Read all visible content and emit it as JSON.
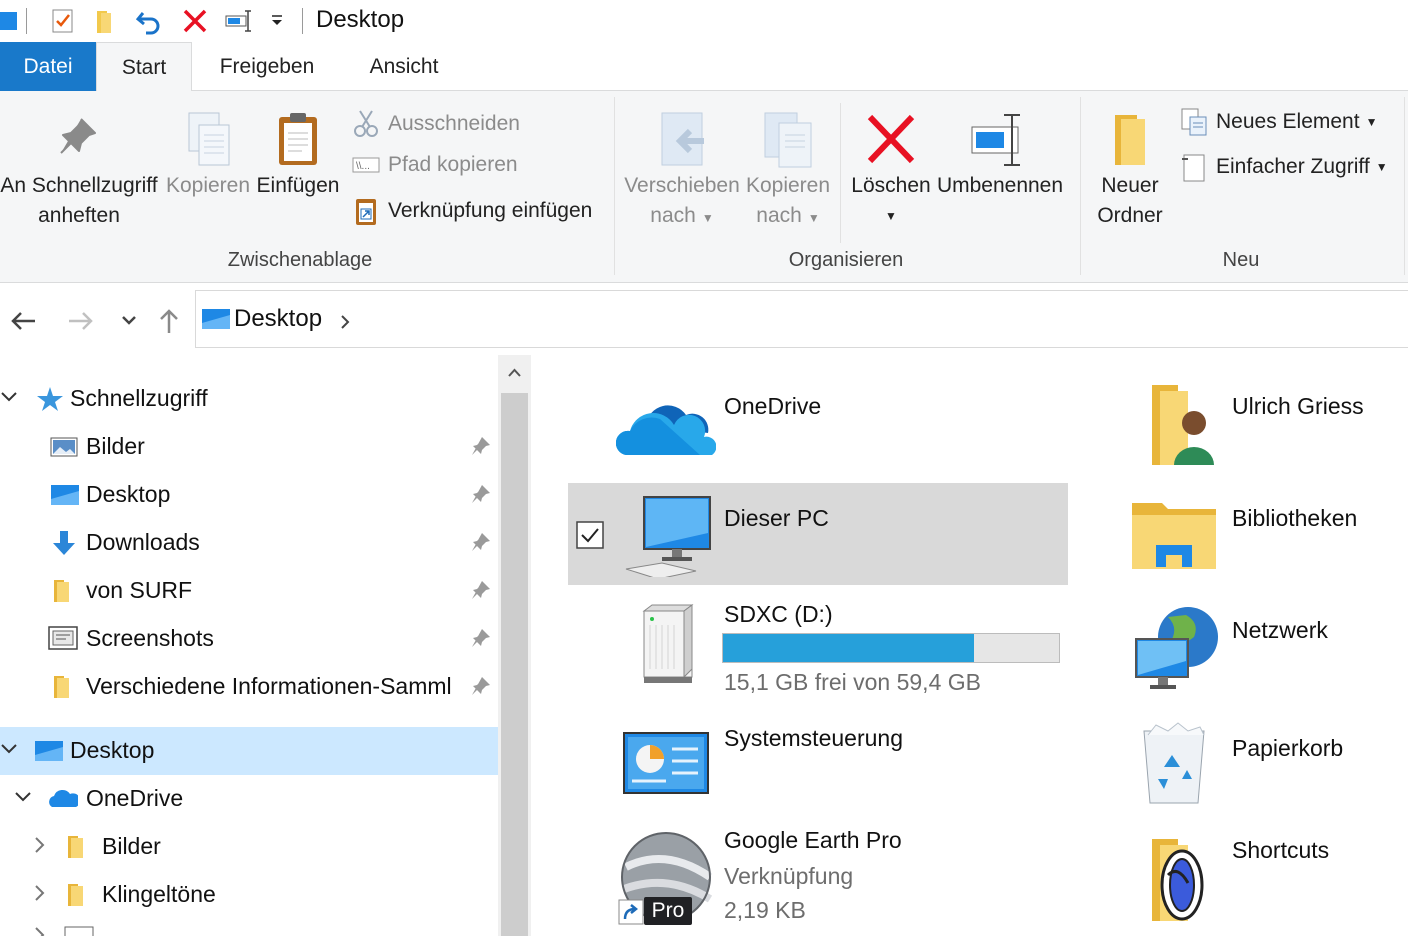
{
  "window": {
    "title": "Desktop"
  },
  "tabs": [
    {
      "label": "Datei"
    },
    {
      "label": "Start"
    },
    {
      "label": "Freigeben"
    },
    {
      "label": "Ansicht"
    }
  ],
  "ribbon": {
    "clipboard": {
      "group_label": "Zwischenablage",
      "pin_line1": "An Schnellzugriff",
      "pin_line2": "anheften",
      "copy": "Kopieren",
      "paste": "Einfügen",
      "cut": "Ausschneiden",
      "copy_path": "Pfad kopieren",
      "paste_shortcut": "Verknüpfung einfügen"
    },
    "organize": {
      "group_label": "Organisieren",
      "move_line1": "Verschieben",
      "move_line2": "nach",
      "copyto_line1": "Kopieren",
      "copyto_line2": "nach",
      "delete": "Löschen",
      "rename": "Umbenennen"
    },
    "new": {
      "group_label": "Neu",
      "folder_line1": "Neuer",
      "folder_line2": "Ordner",
      "new_item": "Neues Element",
      "easy_access": "Einfacher Zugriff"
    }
  },
  "address": {
    "location": "Desktop"
  },
  "sidebar": {
    "items": [
      {
        "label": "Schnellzugriff"
      },
      {
        "label": "Bilder"
      },
      {
        "label": "Desktop"
      },
      {
        "label": "Downloads"
      },
      {
        "label": "von SURF"
      },
      {
        "label": "Screenshots"
      },
      {
        "label": "Verschiedene Informationen-Samml"
      },
      {
        "label": "Desktop"
      },
      {
        "label": "OneDrive"
      },
      {
        "label": "Bilder"
      },
      {
        "label": "Klingeltöne"
      }
    ]
  },
  "content": {
    "items": [
      {
        "name": "OneDrive"
      },
      {
        "name": "Ulrich Griess"
      },
      {
        "name": "Dieser PC"
      },
      {
        "name": "Bibliotheken"
      },
      {
        "name": "SDXC (D:)",
        "free_text": "15,1 GB frei von 59,4 GB",
        "used_fraction": 0.746
      },
      {
        "name": "Netzwerk"
      },
      {
        "name": "Systemsteuerung"
      },
      {
        "name": "Papierkorb"
      },
      {
        "name": "Google Earth Pro",
        "type": "Verknüpfung",
        "size": "2,19 KB",
        "badge": "Pro"
      },
      {
        "name": "Shortcuts"
      }
    ]
  },
  "colors": {
    "accent": "#1979ca",
    "selection": "#cce8ff",
    "drive_fill": "#26a0da",
    "delete_red": "#e81123"
  }
}
